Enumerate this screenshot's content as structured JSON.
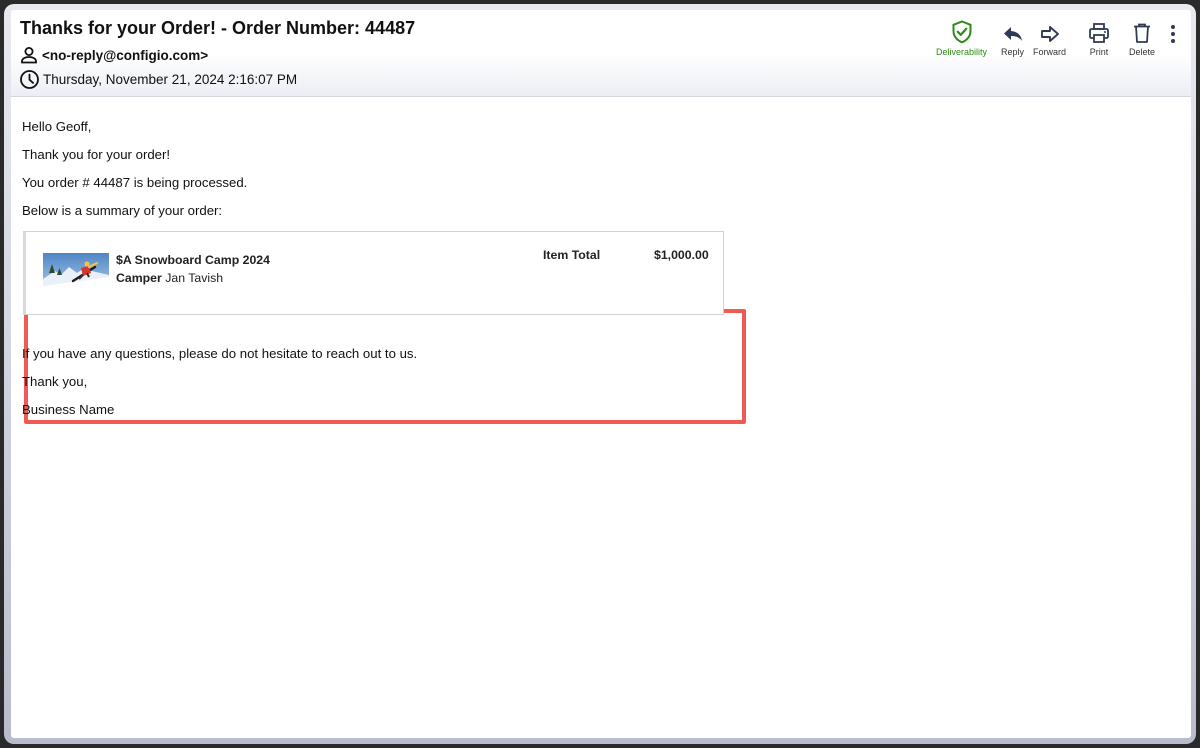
{
  "email": {
    "subject": "Thanks for your Order! - Order Number: 44487",
    "from": "<no-reply@configio.com>",
    "date": "Thursday, November 21, 2024 2:16:07 PM"
  },
  "toolbar": {
    "deliverability": "Deliverability",
    "reply": "Reply",
    "forward": "Forward",
    "print": "Print",
    "delete": "Delete"
  },
  "body": {
    "greeting": "Hello Geoff,",
    "thanks": "Thank you for your order!",
    "processing": "You order # 44487 is being processed.",
    "summary_intro": "Below is a summary of your order:",
    "questions": "If you have any questions, please do not hesitate to reach out to us.",
    "signoff": "Thank you,",
    "business": "Business Name"
  },
  "order": {
    "item_name": "$A Snowboard Camp 2024",
    "camper_label": "Camper",
    "camper_name": "Jan Tavish",
    "total_label": "Item Total",
    "total_value": "$1,000.00"
  },
  "icons": {
    "from": "person-icon",
    "date": "clock-icon",
    "deliverability": "shield-check-icon",
    "reply": "reply-arrow-icon",
    "forward": "forward-arrow-icon",
    "print": "printer-icon",
    "delete": "trash-icon",
    "more": "more-vertical-icon"
  },
  "colors": {
    "highlight": "#ef5a52",
    "deliverability": "#2e8b17",
    "toolbar_icon": "#2f3b55"
  }
}
